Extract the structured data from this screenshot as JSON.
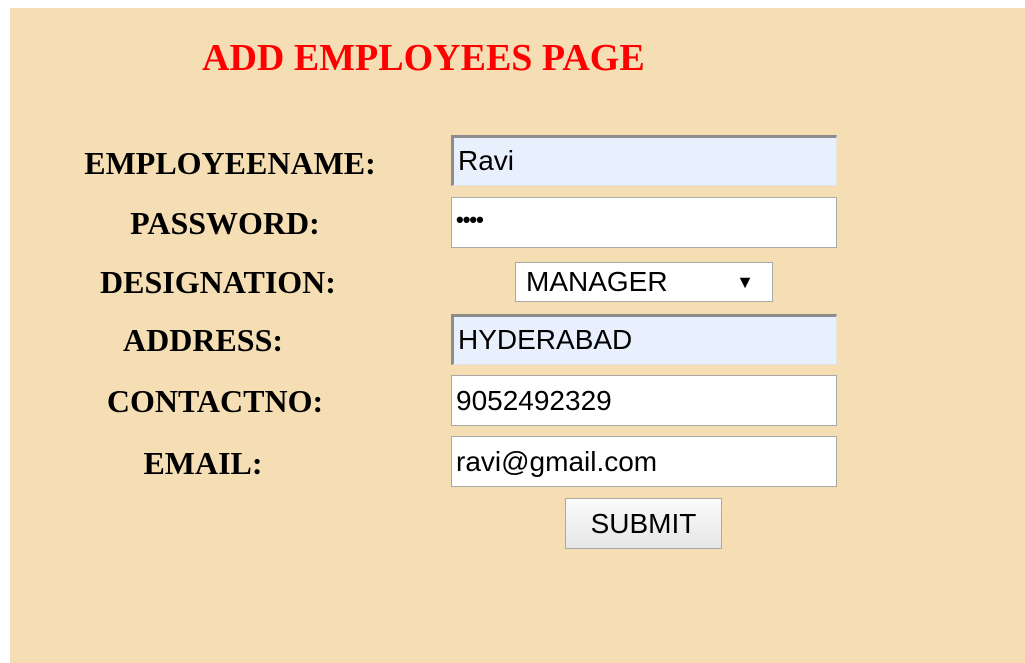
{
  "page": {
    "title": "ADD EMPLOYEES PAGE"
  },
  "form": {
    "employeename": {
      "label": "EMPLOYEENAME:",
      "value": "Ravi"
    },
    "password": {
      "label": "PASSWORD:",
      "value": "••••"
    },
    "designation": {
      "label": "DESIGNATION:",
      "value": "MANAGER"
    },
    "address": {
      "label": "ADDRESS:",
      "value": "HYDERABAD"
    },
    "contactno": {
      "label": "CONTACTNO:",
      "value": "9052492329"
    },
    "email": {
      "label": "EMAIL:",
      "value": "ravi@gmail.com"
    },
    "submit_label": "SUBMIT"
  },
  "colors": {
    "background": "#f5deb3",
    "title": "#ff0000",
    "autofill": "#e8f0fe"
  },
  "icons": {
    "select_caret": "triangle-down"
  }
}
